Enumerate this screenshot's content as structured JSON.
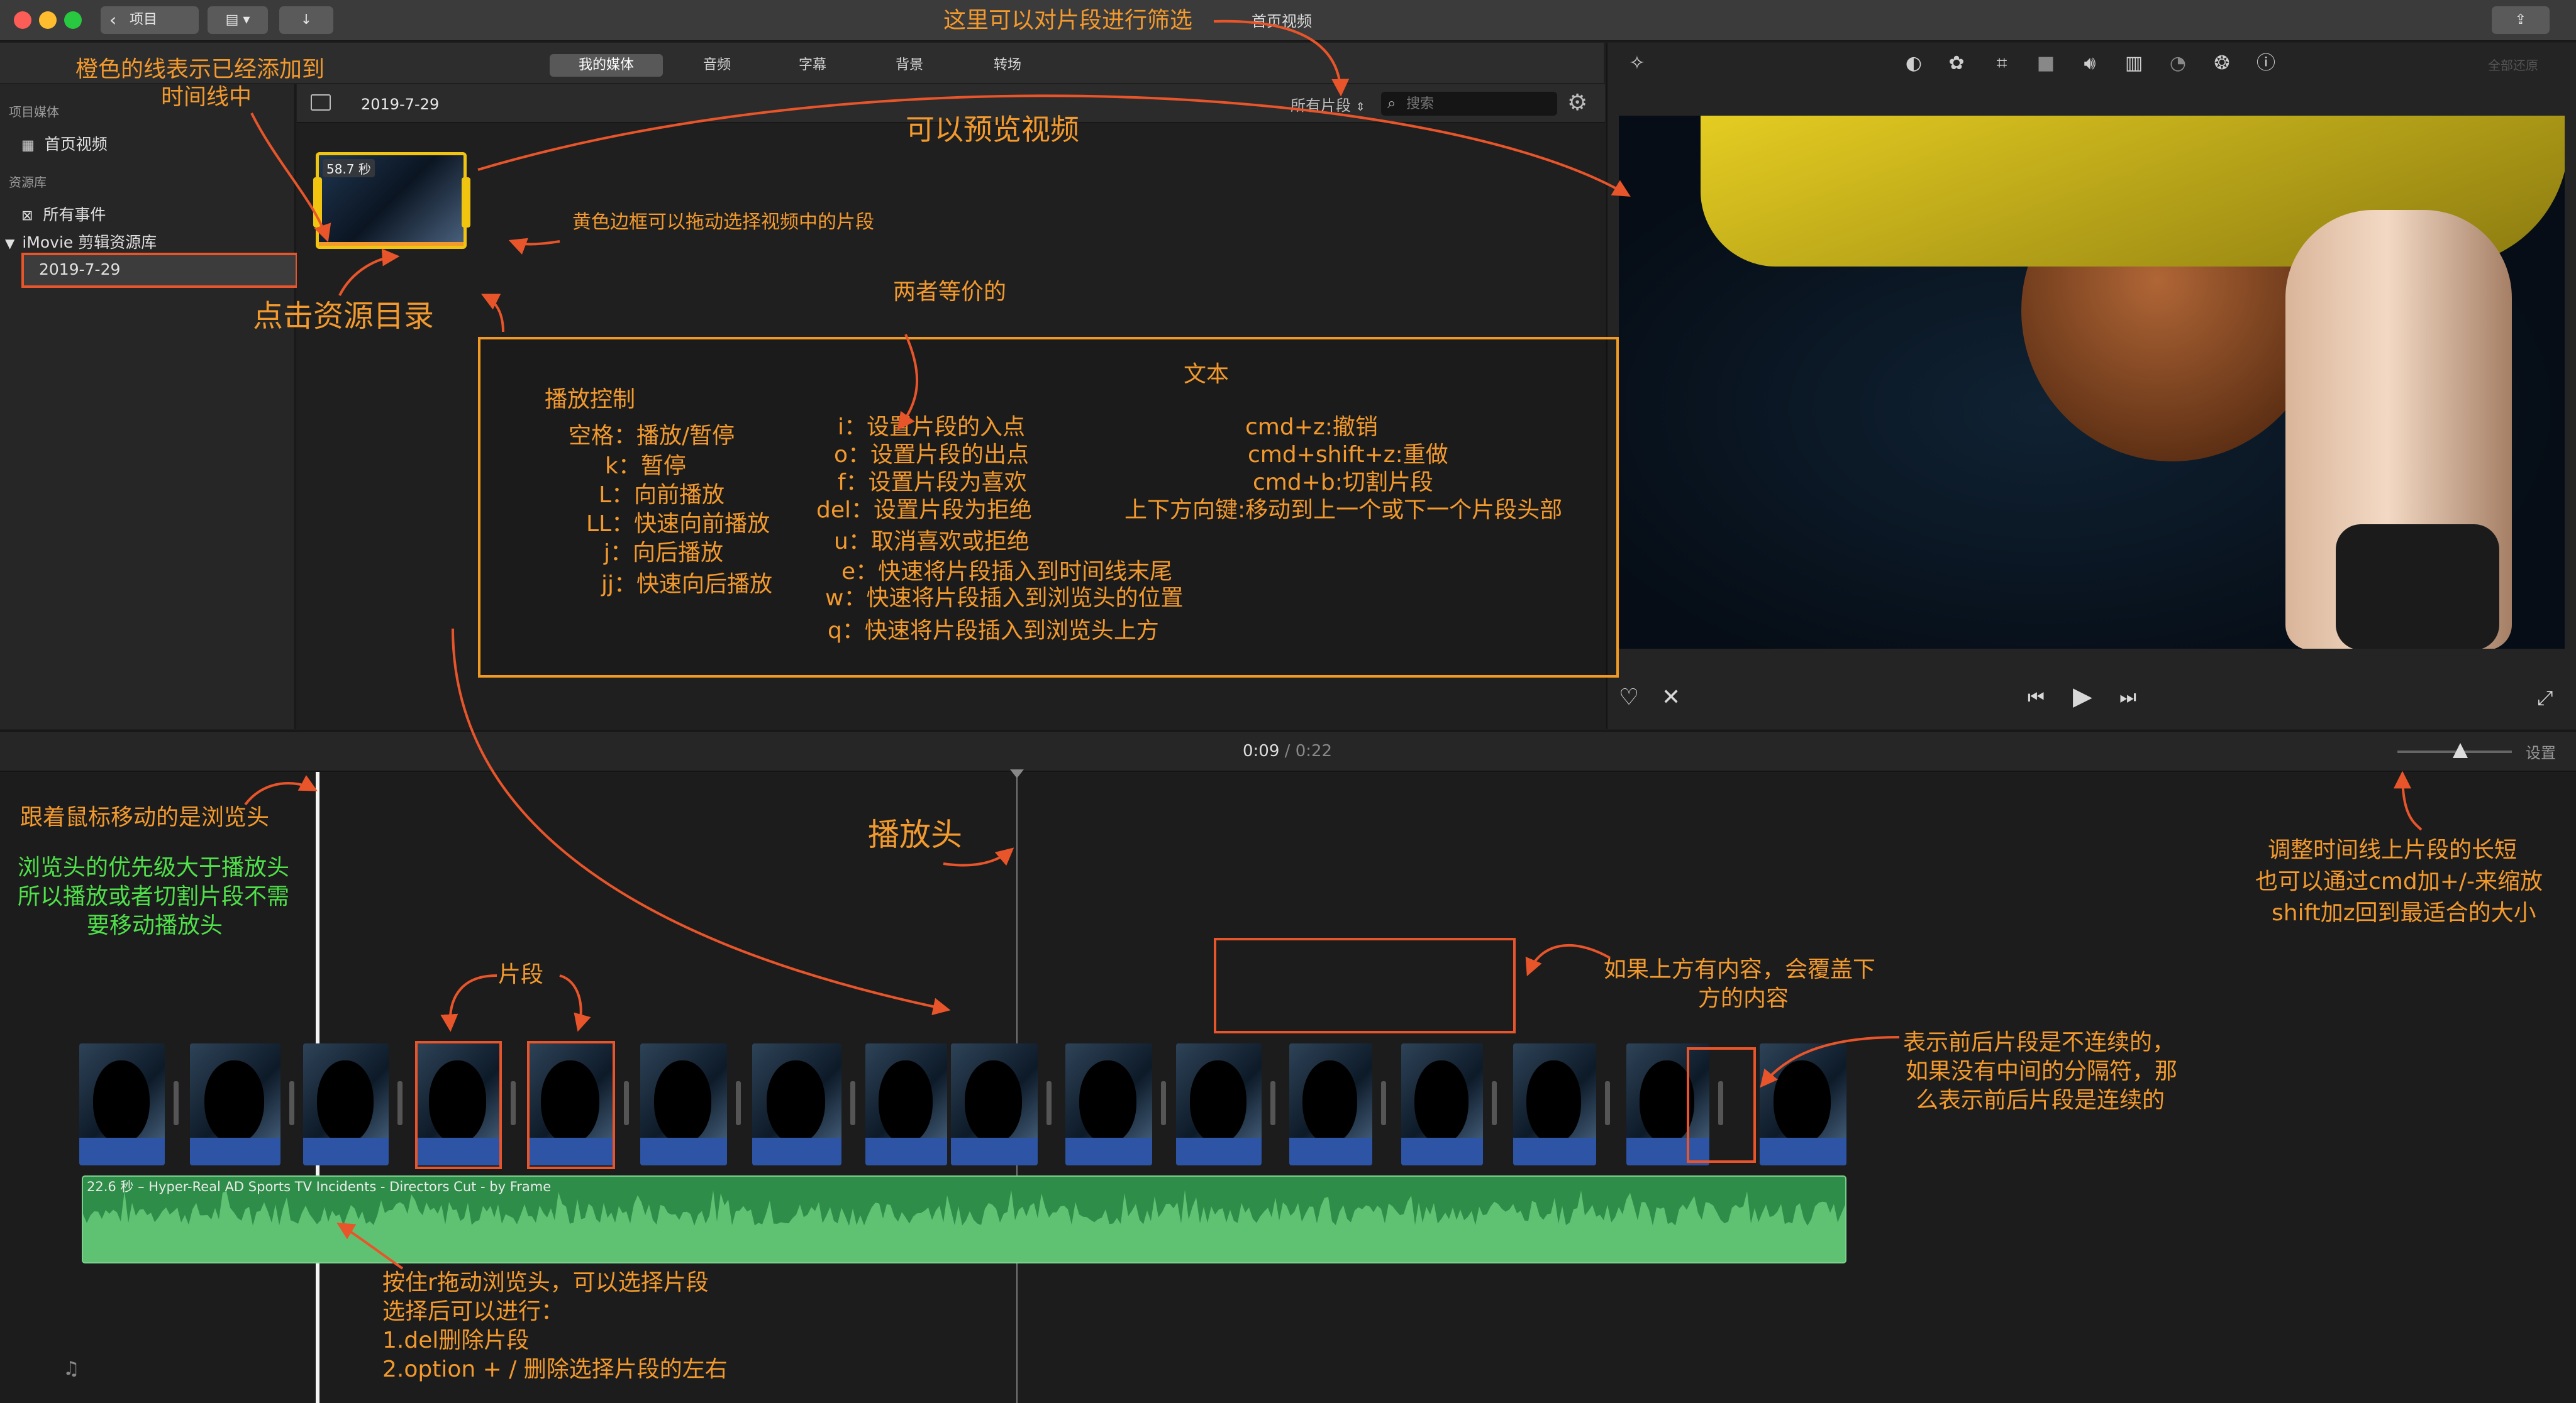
{
  "window": {
    "title": "首页视频",
    "back_button": "项目"
  },
  "browser_tabs": [
    {
      "label": "我的媒体",
      "active": true
    },
    {
      "label": "音频",
      "active": false
    },
    {
      "label": "字幕",
      "active": false
    },
    {
      "label": "背景",
      "active": false
    },
    {
      "label": "转场",
      "active": false
    }
  ],
  "sidebar": {
    "project_media_header": "项目媒体",
    "project_item": "首页视频",
    "libraries_header": "资源库",
    "all_events": "所有事件",
    "library_name": "iMovie 剪辑资源库",
    "event_item": "2019-7-29"
  },
  "browser": {
    "event_title": "2019-7-29",
    "filter_label": "所有片段",
    "search_placeholder": "搜索",
    "clip_duration": "58.7 秒"
  },
  "viewer": {
    "restore_all": "全部还原"
  },
  "timeline": {
    "current_time": "0:09",
    "separator": "/",
    "total_time": "0:22",
    "settings_label": "设置",
    "zoom_level": 0.55,
    "audio_clip_label": "22.6 秒 – Hyper-Real AD Sports TV Incidents - Directors Cut - by Frame"
  },
  "annotations": {
    "filter_note": "这里可以对片段进行筛选",
    "orange_line_note_1": "橙色的线表示已经添加到",
    "orange_line_note_2": "时间线中",
    "preview_note": "可以预览视频",
    "yellow_border_note": "黄色边框可以拖动选择视频中的片段",
    "click_library_note": "点击资源目录",
    "equivalent_note": "两者等价的",
    "skimmer_note": "跟着鼠标移动的是浏览头",
    "skimmer_priority_1": "浏览头的优先级大于播放头",
    "skimmer_priority_2": "所以播放或者切割片段不需",
    "skimmer_priority_3": "要移动播放头",
    "playhead_note": "播放头",
    "clip_note": "片段",
    "overlay_note_1": "如果上方有内容，会覆盖下",
    "overlay_note_2": "方的内容",
    "zoom_note_1": "调整时间线上片段的长短",
    "zoom_note_2": "也可以通过cmd加+/-来缩放",
    "zoom_note_3": "shift加z回到最适合的大小",
    "discontinuous_note_1": "表示前后片段是不连续的，",
    "discontinuous_note_2": "如果没有中间的分隔符，那",
    "discontinuous_note_3": "么表示前后片段是连续的",
    "select_note_1": "按住r拖动浏览头，可以选择片段",
    "select_note_2": "选择后可以进行：",
    "select_note_3": "1.del删除片段",
    "select_note_4": "2.option + / 删除选择片段的左右"
  },
  "shortcuts": {
    "playback_title": "播放控制",
    "playback": [
      "空格：播放/暂停",
      "k：暂停",
      "L：向前播放",
      "LL：快速向前播放",
      "j：向后播放",
      "jj：快速向后播放"
    ],
    "clip": [
      "i：设置片段的入点",
      "o：设置片段的出点",
      "f：设置片段为喜欢",
      "del：设置片段为拒绝",
      "u：取消喜欢或拒绝",
      "e：快速将片段插入到时间线末尾",
      "w：快速将片段插入到浏览头的位置",
      "q：快速将片段插入到浏览头上方"
    ],
    "text_title": "文本",
    "text": [
      "cmd+z:撤销",
      "cmd+shift+z:重做",
      "cmd+b:切割片段",
      "上下方向键:移动到上一个或下一个片段头部"
    ]
  },
  "colors": {
    "annotation": "#f39a2e",
    "annotation_green": "#4fe04a",
    "highlight_red": "#e8552a",
    "audio_green": "#2e8d48",
    "clip_blue": "#2d54a5"
  }
}
